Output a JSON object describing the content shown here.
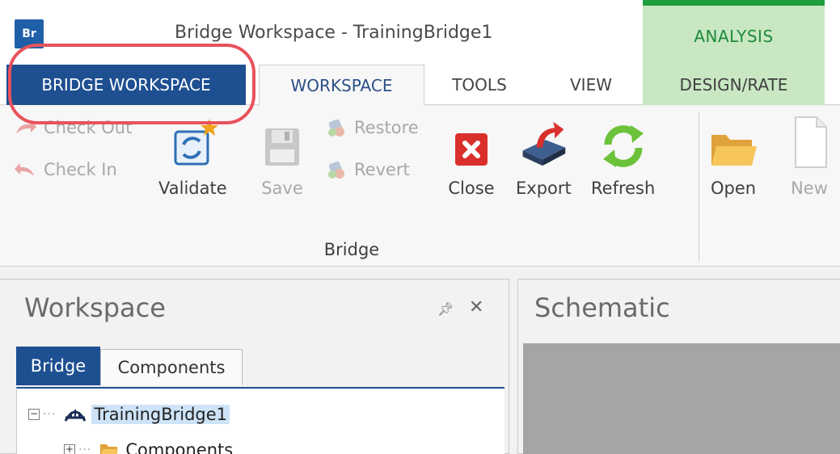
{
  "window": {
    "logo_text": "Br",
    "title": "Bridge Workspace - TrainingBridge1",
    "context_group": "ANALYSIS"
  },
  "tabs": [
    {
      "label": "BRIDGE WORKSPACE",
      "state": "application-menu",
      "highlighted": true
    },
    {
      "label": "WORKSPACE",
      "state": "selected"
    },
    {
      "label": "TOOLS",
      "state": "normal"
    },
    {
      "label": "VIEW",
      "state": "normal"
    },
    {
      "label": "DESIGN/RATE",
      "state": "contextual"
    }
  ],
  "ribbon": {
    "small_buttons": [
      {
        "label": "Check Out",
        "icon": "check-out-arrow-icon",
        "enabled": false
      },
      {
        "label": "Check In",
        "icon": "check-in-arrow-icon",
        "enabled": false
      },
      {
        "label": "Restore",
        "icon": "restore-icon",
        "enabled": false
      },
      {
        "label": "Revert",
        "icon": "revert-icon",
        "enabled": false
      }
    ],
    "large_buttons": [
      {
        "label": "Validate",
        "icon": "validate-icon",
        "enabled": true
      },
      {
        "label": "Save",
        "icon": "save-icon",
        "enabled": false
      },
      {
        "label": "Close",
        "icon": "close-icon",
        "enabled": true
      },
      {
        "label": "Export",
        "icon": "export-icon",
        "enabled": true
      },
      {
        "label": "Refresh",
        "icon": "refresh-icon",
        "enabled": true
      },
      {
        "label": "Open",
        "icon": "open-folder-icon",
        "enabled": true
      },
      {
        "label": "New",
        "icon": "new-document-icon",
        "enabled": false
      }
    ],
    "group_label": "Bridge"
  },
  "workspace_pane": {
    "title": "Workspace",
    "tabs": [
      "Bridge",
      "Components"
    ],
    "active_tab": "Bridge",
    "tree": [
      {
        "label": "TrainingBridge1",
        "icon": "bridge-icon",
        "expanded": true,
        "selected": true
      },
      {
        "label": "Components",
        "icon": "folder-icon",
        "expanded": false
      }
    ]
  },
  "schematic_pane": {
    "title": "Schematic"
  },
  "colors": {
    "primary_blue": "#1d4f91",
    "analysis_green": "#1e9e3c",
    "analysis_fill": "#c9e7c3",
    "highlight_ring": "#e8535c"
  }
}
